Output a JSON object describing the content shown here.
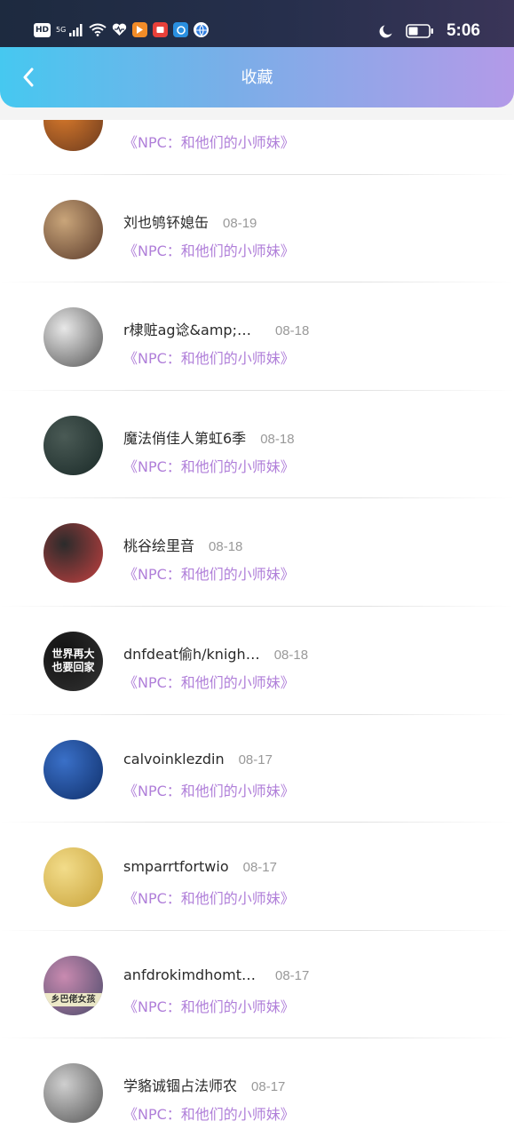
{
  "status_bar": {
    "left_icons": [
      "hd-icon",
      "5g-signal-icon",
      "wifi-icon",
      "heart-icon",
      "app-orange-icon",
      "app-red-icon",
      "app-blue-icon",
      "app-globe-icon"
    ],
    "hd_label": "HD",
    "network_label": "5G",
    "time": "5:06"
  },
  "header": {
    "title": "收藏",
    "gradient_start": "#46c8f0",
    "gradient_end": "#b39ae8"
  },
  "items": [
    {
      "name": "",
      "date": "",
      "book": "《NPC：和他们的小师妹》",
      "avatar_colors": [
        "#d97a2b",
        "#6b3a1e"
      ]
    },
    {
      "name": "刘也鸲钚媳缶",
      "date": "08-19",
      "book": "《NPC：和他们的小师妹》",
      "avatar_colors": [
        "#c9a57a",
        "#5a3a2a"
      ]
    },
    {
      "name": "r棣赃ag谂&amp;菌…",
      "date": "08-18",
      "book": "《NPC：和他们的小师妹》",
      "avatar_colors": [
        "#e8e8e8",
        "#555555"
      ]
    },
    {
      "name": "魔法俏佳人第虹6季",
      "date": "08-18",
      "book": "《NPC：和他们的小师妹》",
      "avatar_colors": [
        "#4a5a55",
        "#1a2a28"
      ]
    },
    {
      "name": "桃谷绘里音",
      "date": "08-18",
      "book": "《NPC：和他们的小师妹》",
      "avatar_colors": [
        "#2b2b2b",
        "#c44040"
      ]
    },
    {
      "name": "dnfdeat偷h/knigh…",
      "date": "08-18",
      "book": "《NPC：和他们的小师妹》",
      "avatar_colors": [
        "#111111",
        "#333333"
      ],
      "avatar_text": [
        "世界再大",
        "也要回家"
      ]
    },
    {
      "name": "calvoinklezdin",
      "date": "08-17",
      "book": "《NPC：和他们的小师妹》",
      "avatar_colors": [
        "#3a70c8",
        "#0f2f6a"
      ]
    },
    {
      "name": "smparrtfortwio",
      "date": "08-17",
      "book": "《NPC：和他们的小师妹》",
      "avatar_colors": [
        "#f2dc8a",
        "#c9a33a"
      ]
    },
    {
      "name": "anfdrokimdhomtme",
      "date": "08-17",
      "book": "《NPC：和他们的小师妹》",
      "avatar_colors": [
        "#c98ab0",
        "#4a4a6a"
      ],
      "avatar_text": [
        "乡巴佬女孩"
      ]
    },
    {
      "name": "学貉诚锢占法师农",
      "date": "08-17",
      "book": "《NPC：和他们的小师妹》",
      "avatar_colors": [
        "#cfcfcf",
        "#555555"
      ]
    }
  ]
}
